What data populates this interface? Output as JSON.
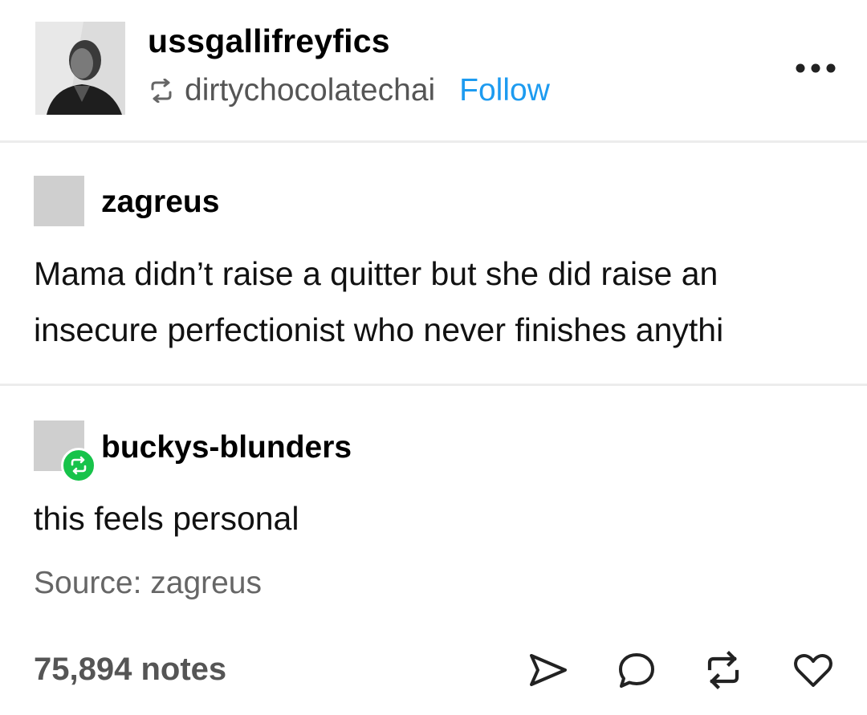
{
  "header": {
    "blog_name": "ussgallifreyfics",
    "reblogged_from": "dirtychocolatechai",
    "follow_label": "Follow",
    "avatar_icon": "blog-avatar-photo",
    "more_icon": "ellipsis-icon"
  },
  "trail": [
    {
      "username": "zagreus",
      "text_lines": [
        "Mama didn’t raise a quitter but she did raise an",
        "insecure perfectionist who never finishes anythi"
      ]
    },
    {
      "username": "buckys-blunders",
      "badge_icon": "reblog-badge-icon",
      "text_lines": [
        "this feels personal"
      ]
    }
  ],
  "source": {
    "label": "Source:",
    "name": "zagreus"
  },
  "footer": {
    "notes_label": "75,894 notes",
    "actions": [
      "share-icon",
      "reply-icon",
      "reblog-icon",
      "like-icon"
    ]
  },
  "colors": {
    "follow": "#1d9bf0",
    "badge": "#17c34a",
    "muted_text": "#555555",
    "avatar_placeholder": "#cfcfcf"
  }
}
